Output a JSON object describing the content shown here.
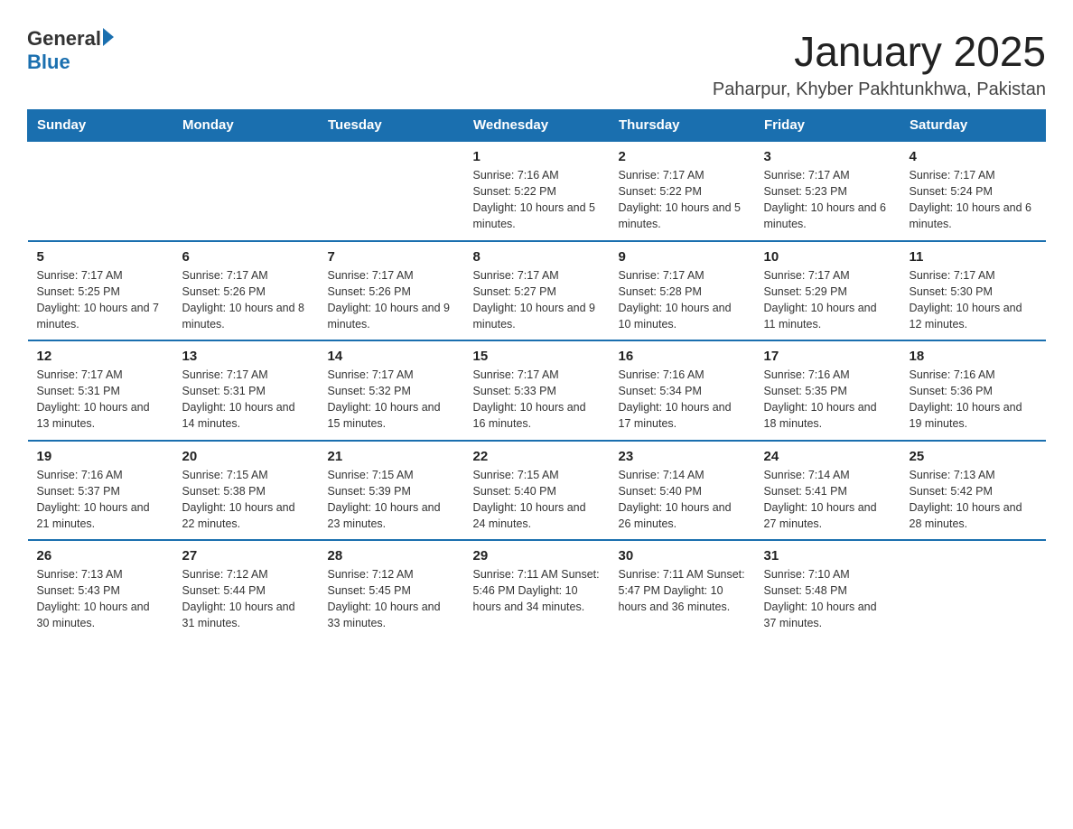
{
  "header": {
    "logo_general": "General",
    "logo_blue": "Blue",
    "title": "January 2025",
    "subtitle": "Paharpur, Khyber Pakhtunkhwa, Pakistan"
  },
  "days_of_week": [
    "Sunday",
    "Monday",
    "Tuesday",
    "Wednesday",
    "Thursday",
    "Friday",
    "Saturday"
  ],
  "weeks": [
    [
      {
        "day": "",
        "info": ""
      },
      {
        "day": "",
        "info": ""
      },
      {
        "day": "",
        "info": ""
      },
      {
        "day": "1",
        "info": "Sunrise: 7:16 AM\nSunset: 5:22 PM\nDaylight: 10 hours and 5 minutes."
      },
      {
        "day": "2",
        "info": "Sunrise: 7:17 AM\nSunset: 5:22 PM\nDaylight: 10 hours and 5 minutes."
      },
      {
        "day": "3",
        "info": "Sunrise: 7:17 AM\nSunset: 5:23 PM\nDaylight: 10 hours and 6 minutes."
      },
      {
        "day": "4",
        "info": "Sunrise: 7:17 AM\nSunset: 5:24 PM\nDaylight: 10 hours and 6 minutes."
      }
    ],
    [
      {
        "day": "5",
        "info": "Sunrise: 7:17 AM\nSunset: 5:25 PM\nDaylight: 10 hours and 7 minutes."
      },
      {
        "day": "6",
        "info": "Sunrise: 7:17 AM\nSunset: 5:26 PM\nDaylight: 10 hours and 8 minutes."
      },
      {
        "day": "7",
        "info": "Sunrise: 7:17 AM\nSunset: 5:26 PM\nDaylight: 10 hours and 9 minutes."
      },
      {
        "day": "8",
        "info": "Sunrise: 7:17 AM\nSunset: 5:27 PM\nDaylight: 10 hours and 9 minutes."
      },
      {
        "day": "9",
        "info": "Sunrise: 7:17 AM\nSunset: 5:28 PM\nDaylight: 10 hours and 10 minutes."
      },
      {
        "day": "10",
        "info": "Sunrise: 7:17 AM\nSunset: 5:29 PM\nDaylight: 10 hours and 11 minutes."
      },
      {
        "day": "11",
        "info": "Sunrise: 7:17 AM\nSunset: 5:30 PM\nDaylight: 10 hours and 12 minutes."
      }
    ],
    [
      {
        "day": "12",
        "info": "Sunrise: 7:17 AM\nSunset: 5:31 PM\nDaylight: 10 hours and 13 minutes."
      },
      {
        "day": "13",
        "info": "Sunrise: 7:17 AM\nSunset: 5:31 PM\nDaylight: 10 hours and 14 minutes."
      },
      {
        "day": "14",
        "info": "Sunrise: 7:17 AM\nSunset: 5:32 PM\nDaylight: 10 hours and 15 minutes."
      },
      {
        "day": "15",
        "info": "Sunrise: 7:17 AM\nSunset: 5:33 PM\nDaylight: 10 hours and 16 minutes."
      },
      {
        "day": "16",
        "info": "Sunrise: 7:16 AM\nSunset: 5:34 PM\nDaylight: 10 hours and 17 minutes."
      },
      {
        "day": "17",
        "info": "Sunrise: 7:16 AM\nSunset: 5:35 PM\nDaylight: 10 hours and 18 minutes."
      },
      {
        "day": "18",
        "info": "Sunrise: 7:16 AM\nSunset: 5:36 PM\nDaylight: 10 hours and 19 minutes."
      }
    ],
    [
      {
        "day": "19",
        "info": "Sunrise: 7:16 AM\nSunset: 5:37 PM\nDaylight: 10 hours and 21 minutes."
      },
      {
        "day": "20",
        "info": "Sunrise: 7:15 AM\nSunset: 5:38 PM\nDaylight: 10 hours and 22 minutes."
      },
      {
        "day": "21",
        "info": "Sunrise: 7:15 AM\nSunset: 5:39 PM\nDaylight: 10 hours and 23 minutes."
      },
      {
        "day": "22",
        "info": "Sunrise: 7:15 AM\nSunset: 5:40 PM\nDaylight: 10 hours and 24 minutes."
      },
      {
        "day": "23",
        "info": "Sunrise: 7:14 AM\nSunset: 5:40 PM\nDaylight: 10 hours and 26 minutes."
      },
      {
        "day": "24",
        "info": "Sunrise: 7:14 AM\nSunset: 5:41 PM\nDaylight: 10 hours and 27 minutes."
      },
      {
        "day": "25",
        "info": "Sunrise: 7:13 AM\nSunset: 5:42 PM\nDaylight: 10 hours and 28 minutes."
      }
    ],
    [
      {
        "day": "26",
        "info": "Sunrise: 7:13 AM\nSunset: 5:43 PM\nDaylight: 10 hours and 30 minutes."
      },
      {
        "day": "27",
        "info": "Sunrise: 7:12 AM\nSunset: 5:44 PM\nDaylight: 10 hours and 31 minutes."
      },
      {
        "day": "28",
        "info": "Sunrise: 7:12 AM\nSunset: 5:45 PM\nDaylight: 10 hours and 33 minutes."
      },
      {
        "day": "29",
        "info": "Sunrise: 7:11 AM\nSunset: 5:46 PM\nDaylight: 10 hours and 34 minutes."
      },
      {
        "day": "30",
        "info": "Sunrise: 7:11 AM\nSunset: 5:47 PM\nDaylight: 10 hours and 36 minutes."
      },
      {
        "day": "31",
        "info": "Sunrise: 7:10 AM\nSunset: 5:48 PM\nDaylight: 10 hours and 37 minutes."
      },
      {
        "day": "",
        "info": ""
      }
    ]
  ]
}
